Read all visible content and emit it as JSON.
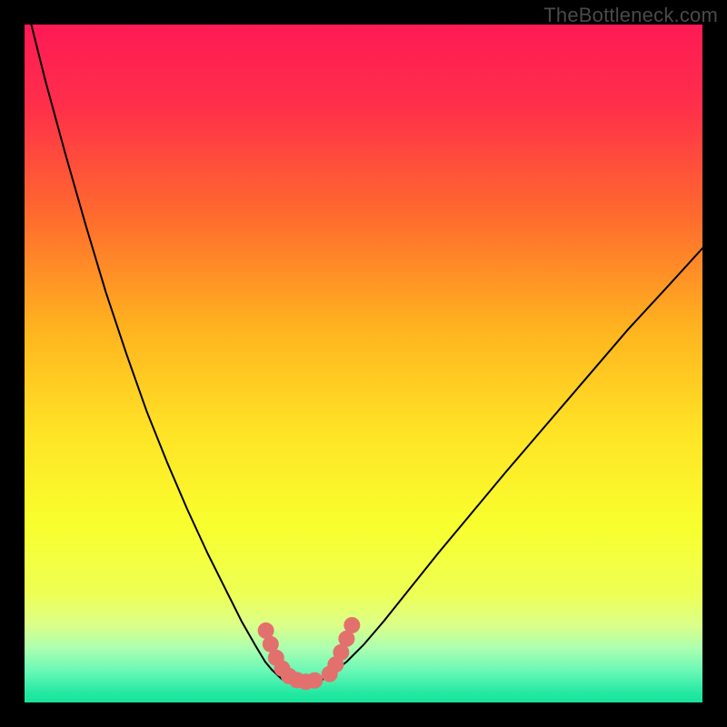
{
  "watermark": "TheBottleneck.com",
  "chart_data": {
    "type": "line",
    "title": "",
    "xlabel": "",
    "ylabel": "",
    "xlim": [
      0,
      100
    ],
    "ylim": [
      0,
      100
    ],
    "background_gradient": [
      {
        "stop": 0.0,
        "color": "#ff1a55"
      },
      {
        "stop": 0.12,
        "color": "#ff2f4a"
      },
      {
        "stop": 0.28,
        "color": "#ff6a2e"
      },
      {
        "stop": 0.45,
        "color": "#ffb41f"
      },
      {
        "stop": 0.6,
        "color": "#ffe326"
      },
      {
        "stop": 0.74,
        "color": "#f8ff2e"
      },
      {
        "stop": 0.84,
        "color": "#eeff55"
      },
      {
        "stop": 0.885,
        "color": "#dcff88"
      },
      {
        "stop": 0.92,
        "color": "#acffb0"
      },
      {
        "stop": 0.955,
        "color": "#66f7b6"
      },
      {
        "stop": 0.985,
        "color": "#25e9a3"
      },
      {
        "stop": 1.0,
        "color": "#17e39b"
      }
    ],
    "series": [
      {
        "name": "left-curve",
        "stroke": "#000000",
        "stroke_width": 2,
        "x": [
          1,
          3,
          6,
          9,
          12,
          15,
          18,
          21,
          24,
          27,
          30,
          32,
          34,
          35.5,
          36.5
        ],
        "y": [
          100,
          92,
          81,
          70.5,
          60.5,
          51.5,
          43,
          35.5,
          28.5,
          22,
          16,
          12,
          8.5,
          6,
          4.8
        ]
      },
      {
        "name": "right-curve",
        "stroke": "#000000",
        "stroke_width": 2,
        "x": [
          46,
          47.5,
          50,
          53,
          57,
          61,
          66,
          71,
          77,
          83,
          89,
          95,
          100
        ],
        "y": [
          4.8,
          6,
          8.5,
          12,
          17,
          22,
          28,
          34,
          41,
          48,
          55,
          61.5,
          67
        ]
      },
      {
        "name": "flat-minimum",
        "stroke": "#000000",
        "stroke_width": 2,
        "x": [
          36.5,
          38,
          41,
          44,
          46
        ],
        "y": [
          4.8,
          3.4,
          3.0,
          3.4,
          4.8
        ]
      }
    ],
    "markers": [
      {
        "name": "left-marker-cluster",
        "color": "#e2716e",
        "radius": 9,
        "points": [
          [
            35.6,
            10.6
          ],
          [
            36.3,
            8.6
          ],
          [
            37.1,
            6.6
          ],
          [
            38.0,
            5.0
          ],
          [
            39.0,
            3.9
          ],
          [
            40.2,
            3.3
          ],
          [
            41.5,
            3.05
          ],
          [
            42.8,
            3.25
          ]
        ]
      },
      {
        "name": "right-marker-cluster",
        "color": "#e2716e",
        "radius": 9,
        "points": [
          [
            45.0,
            4.2
          ],
          [
            45.9,
            5.6
          ],
          [
            46.7,
            7.4
          ],
          [
            47.5,
            9.4
          ],
          [
            48.3,
            11.4
          ]
        ]
      }
    ]
  }
}
